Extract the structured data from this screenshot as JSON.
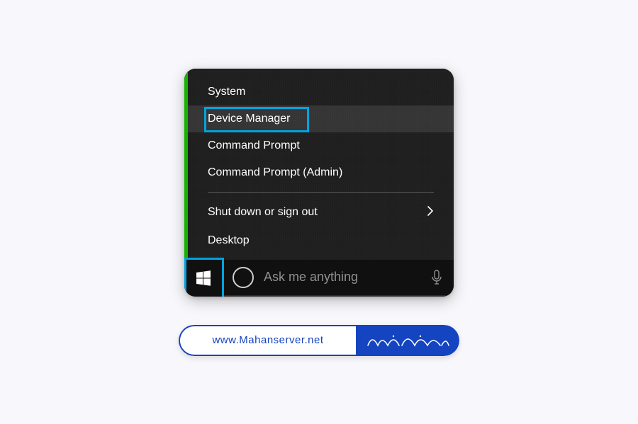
{
  "menu": {
    "items": [
      {
        "label": "System",
        "hovered": false,
        "hasChevron": false
      },
      {
        "label": "Device Manager",
        "hovered": true,
        "hasChevron": false,
        "highlighted": true
      },
      {
        "label": "Command Prompt",
        "hovered": false,
        "hasChevron": false
      },
      {
        "label": "Command Prompt (Admin)",
        "hovered": false,
        "hasChevron": false
      },
      {
        "divider": true
      },
      {
        "label": "Shut down or sign out",
        "hovered": false,
        "hasChevron": true
      },
      {
        "label": "Desktop",
        "hovered": false,
        "hasChevron": false
      }
    ]
  },
  "taskbar": {
    "search_placeholder": "Ask me anything"
  },
  "watermark": {
    "url": "www.Mahanserver.net",
    "brand": "ماهان سرور"
  },
  "colors": {
    "highlight_box": "#00a3e0",
    "green_strip": "#16b300",
    "watermark_blue": "#1544c0"
  }
}
